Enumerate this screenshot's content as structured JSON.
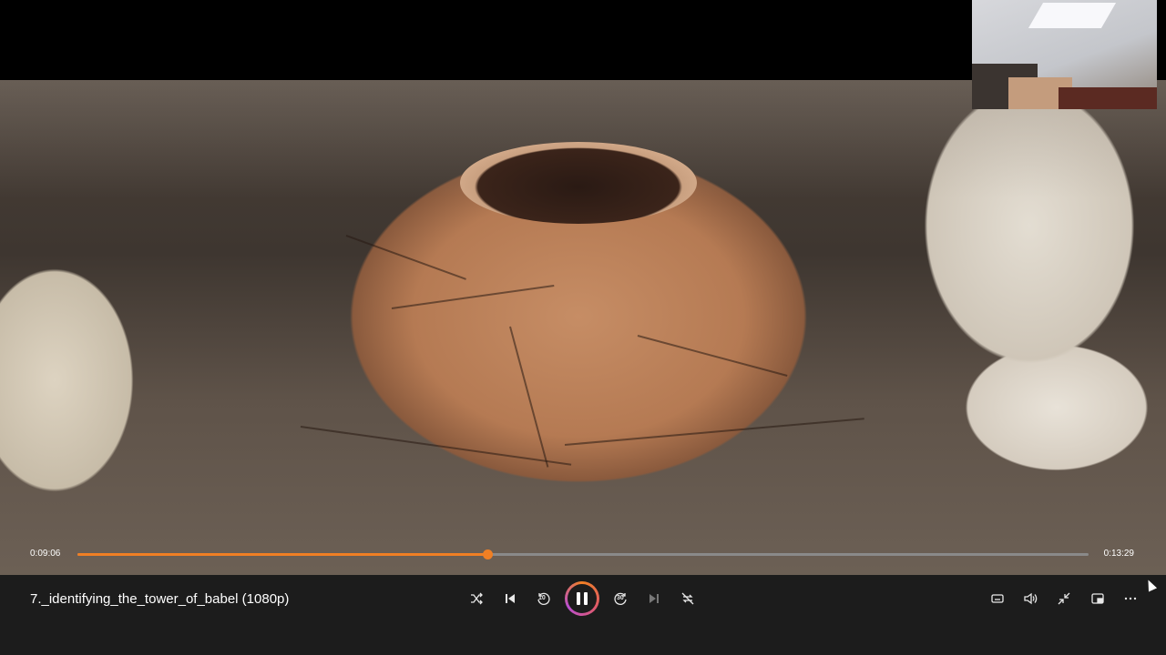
{
  "player": {
    "title": "7._identifying_the_tower_of_babel (1080p)",
    "current_time": "0:09:06",
    "duration": "0:13:29",
    "progress": 0.405,
    "accent_color": "#f07f24",
    "skip_back_seconds": "10",
    "skip_forward_seconds": "30"
  },
  "controls": {
    "left": [
      "shuffle-icon",
      "previous-icon",
      "skip-back-10-icon",
      "pause-icon",
      "skip-forward-30-icon",
      "next-icon",
      "repeat-off-icon"
    ],
    "right": [
      "captions-icon",
      "volume-icon",
      "exit-fullscreen-icon",
      "mini-player-icon",
      "more-options-icon"
    ]
  }
}
